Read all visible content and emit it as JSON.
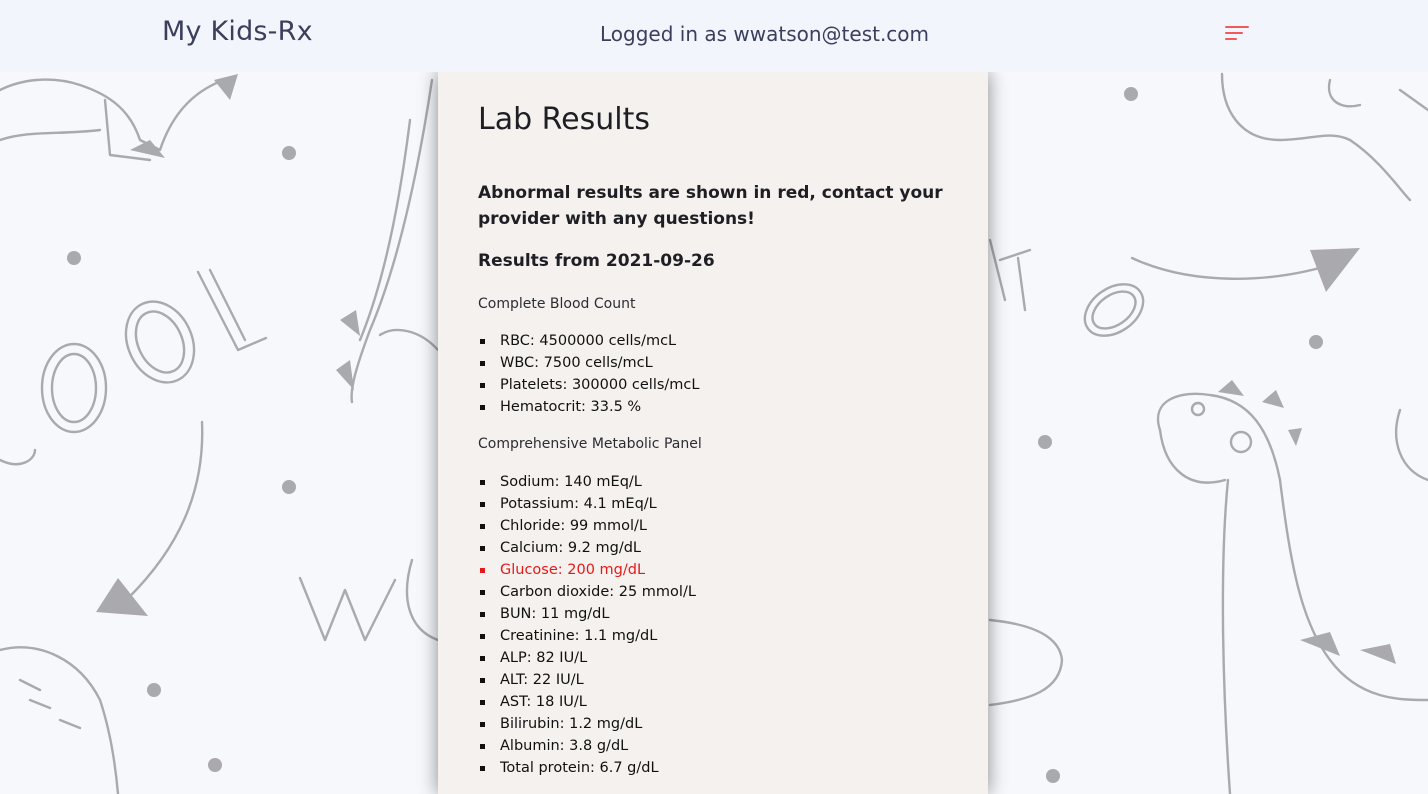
{
  "header": {
    "brand": "My Kids-Rx",
    "logged_in_text": "Logged in as wwatson@test.com",
    "menu_icon": "hamburger-menu-icon",
    "accent_color": "#ef5a5a"
  },
  "page": {
    "title": "Lab Results",
    "notice": "Abnormal results are shown in red, contact your provider with any questions!",
    "results_date_label": "Results from 2021-09-26"
  },
  "panels": [
    {
      "name": "Complete Blood Count",
      "results": [
        {
          "text": "RBC: 4500000 cells/mcL",
          "abnormal": false
        },
        {
          "text": "WBC: 7500 cells/mcL",
          "abnormal": false
        },
        {
          "text": "Platelets: 300000 cells/mcL",
          "abnormal": false
        },
        {
          "text": "Hematocrit: 33.5 %",
          "abnormal": false
        }
      ]
    },
    {
      "name": "Comprehensive Metabolic Panel",
      "results": [
        {
          "text": "Sodium: 140 mEq/L",
          "abnormal": false
        },
        {
          "text": "Potassium: 4.1 mEq/L",
          "abnormal": false
        },
        {
          "text": "Chloride: 99 mmol/L",
          "abnormal": false
        },
        {
          "text": "Calcium: 9.2 mg/dL",
          "abnormal": false
        },
        {
          "text": "Glucose: 200 mg/dL",
          "abnormal": true
        },
        {
          "text": "Carbon dioxide: 25 mmol/L",
          "abnormal": false
        },
        {
          "text": "BUN: 11 mg/dL",
          "abnormal": false
        },
        {
          "text": "Creatinine: 1.1 mg/dL",
          "abnormal": false
        },
        {
          "text": "ALP: 82 IU/L",
          "abnormal": false
        },
        {
          "text": "ALT: 22 IU/L",
          "abnormal": false
        },
        {
          "text": "AST: 18 IU/L",
          "abnormal": false
        },
        {
          "text": "Bilirubin: 1.2 mg/dL",
          "abnormal": false
        },
        {
          "text": "Albumin: 3.8 g/dL",
          "abnormal": false
        },
        {
          "text": "Total protein: 6.7 g/dL",
          "abnormal": false
        }
      ]
    }
  ],
  "colors": {
    "abnormal": "#e41a1a",
    "card_background": "#f4f1ee",
    "page_background": "#f6f8fc"
  }
}
